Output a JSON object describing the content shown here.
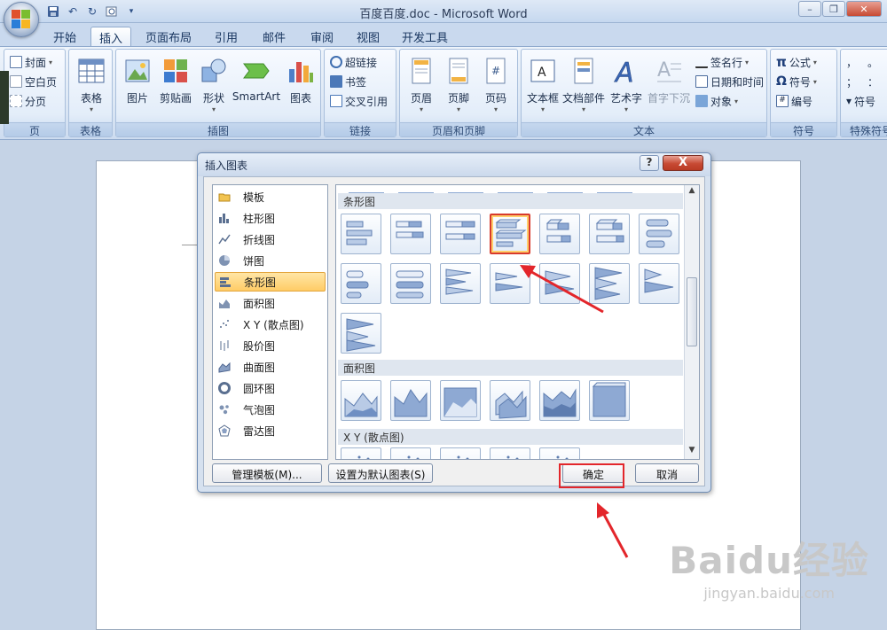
{
  "window": {
    "title": "百度百度.doc - Microsoft Word"
  },
  "tabs": [
    {
      "label": "开始"
    },
    {
      "label": "插入"
    },
    {
      "label": "页面布局"
    },
    {
      "label": "引用"
    },
    {
      "label": "邮件"
    },
    {
      "label": "审阅"
    },
    {
      "label": "视图"
    },
    {
      "label": "开发工具"
    }
  ],
  "ribbon": {
    "pages": {
      "cover": "封面",
      "blank": "空白页",
      "break": "分页",
      "label": "页"
    },
    "tables": {
      "table": "表格",
      "label": "表格"
    },
    "illustrations": {
      "picture": "图片",
      "clipart": "剪贴画",
      "shapes": "形状",
      "smartart": "SmartArt",
      "chart": "图表",
      "label": "插图"
    },
    "links": {
      "hyperlink": "超链接",
      "bookmark": "书签",
      "crossref": "交叉引用",
      "label": "链接"
    },
    "header_footer": {
      "header": "页眉",
      "footer": "页脚",
      "page_number": "页码",
      "label": "页眉和页脚"
    },
    "text": {
      "textbox": "文本框",
      "quickparts": "文档部件",
      "wordart": "艺术字",
      "dropcap": "首字下沉",
      "signature": "签名行",
      "datetime": "日期和时间",
      "object": "对象",
      "label": "文本"
    },
    "symbols": {
      "equation": "公式",
      "symbol": "符号",
      "number": "编号",
      "label": "符号"
    },
    "special": {
      "comma": "，",
      "period": "。",
      "semicolon": "；",
      "colon": "：",
      "symbol": "符号",
      "label": "特殊符号"
    }
  },
  "dialog": {
    "title": "插入图表",
    "help": "?",
    "close": "X",
    "categories": [
      {
        "label": "模板",
        "icon": "folder-icon"
      },
      {
        "label": "柱形图",
        "icon": "column-chart-icon"
      },
      {
        "label": "折线图",
        "icon": "line-chart-icon"
      },
      {
        "label": "饼图",
        "icon": "pie-chart-icon"
      },
      {
        "label": "条形图",
        "icon": "bar-chart-icon"
      },
      {
        "label": "面积图",
        "icon": "area-chart-icon"
      },
      {
        "label": "X Y (散点图)",
        "icon": "scatter-chart-icon"
      },
      {
        "label": "股价图",
        "icon": "stock-chart-icon"
      },
      {
        "label": "曲面图",
        "icon": "surface-chart-icon"
      },
      {
        "label": "圆环图",
        "icon": "doughnut-chart-icon"
      },
      {
        "label": "气泡图",
        "icon": "bubble-chart-icon"
      },
      {
        "label": "雷达图",
        "icon": "radar-chart-icon"
      }
    ],
    "selected_category": "条形图",
    "sections": {
      "bar": "条形图",
      "area": "面积图",
      "scatter": "X Y (散点图)"
    },
    "buttons": {
      "manage_templates": "管理模板(M)...",
      "set_default": "设置为默认图表(S)",
      "ok": "确定",
      "cancel": "取消"
    }
  },
  "watermark": {
    "brand": "Baidu经验",
    "url": "jingyan.baidu.com"
  },
  "colors": {
    "highlight": "#e3262b",
    "selection": "#ffcc66",
    "ribbon": "#dde8f5"
  }
}
